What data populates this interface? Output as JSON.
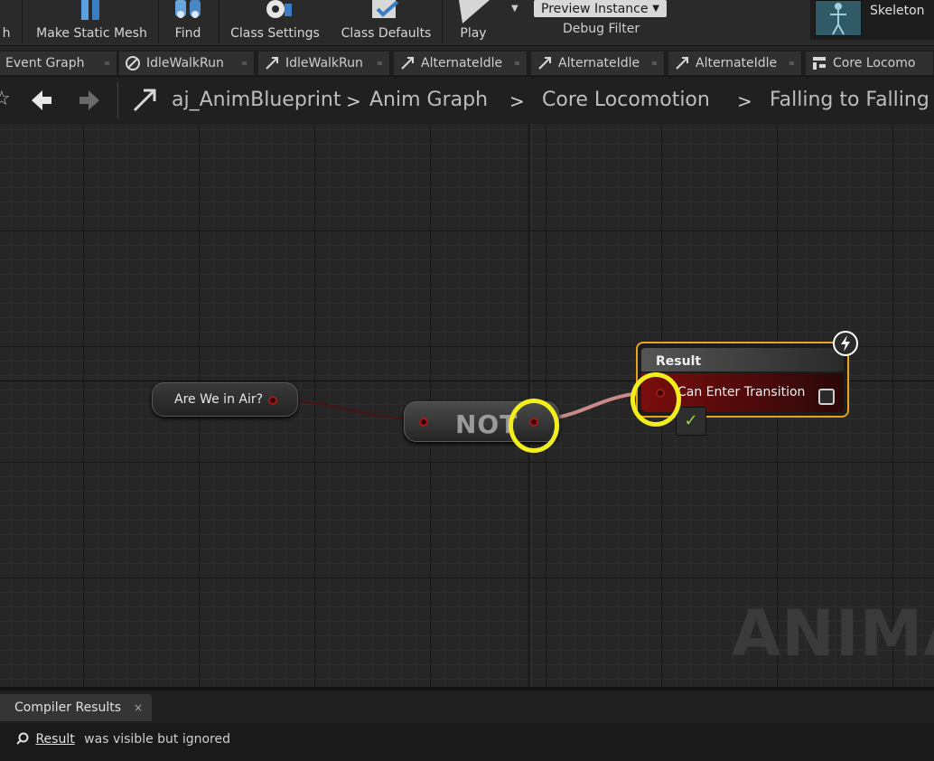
{
  "toolbar": {
    "partial_left_label": "h",
    "buttons": [
      {
        "label": "Make Static Mesh",
        "icon": "static-mesh-icon"
      },
      {
        "label": "Find",
        "icon": "binoculars-icon"
      },
      {
        "label": "Class Settings",
        "icon": "gear-icon"
      },
      {
        "label": "Class Defaults",
        "icon": "checklist-icon"
      },
      {
        "label": "Play",
        "icon": "play-icon"
      }
    ],
    "preview_instance": "Preview Instance",
    "debug_filter_label": "Debug Filter",
    "skeleton_label": "Skeleton"
  },
  "tabs": [
    {
      "label": "Event Graph",
      "icon": "graph-icon"
    },
    {
      "label": "IdleWalkRun",
      "icon": "blendspace-icon"
    },
    {
      "label": "IdleWalkRun",
      "icon": "transition-icon"
    },
    {
      "label": "AlternateIdle",
      "icon": "transition-icon"
    },
    {
      "label": "AlternateIdle",
      "icon": "transition-icon"
    },
    {
      "label": "AlternateIdle",
      "icon": "transition-icon"
    },
    {
      "label": "Core Locomo",
      "icon": "state-machine-icon"
    }
  ],
  "breadcrumb": {
    "items": [
      "aj_AnimBlueprint",
      "Anim Graph",
      "Core Locomotion",
      "Falling to Falling"
    ]
  },
  "graph": {
    "watermark": "ANIMAT",
    "nodes": {
      "air_variable": "Are We in Air?",
      "not_label": "NOT",
      "result_title": "Result",
      "result_pin_label": "Can Enter Transition"
    },
    "status_glyph": "✓"
  },
  "compiler": {
    "tab_label": "Compiler Results",
    "close_glyph": "×",
    "log": [
      {
        "link": "Result",
        "text": "was visible but ignored"
      }
    ]
  },
  "colors": {
    "highlight": "#f2ee1e",
    "result_border": "#e8a21c",
    "bool_pin": "#a01a1a"
  }
}
